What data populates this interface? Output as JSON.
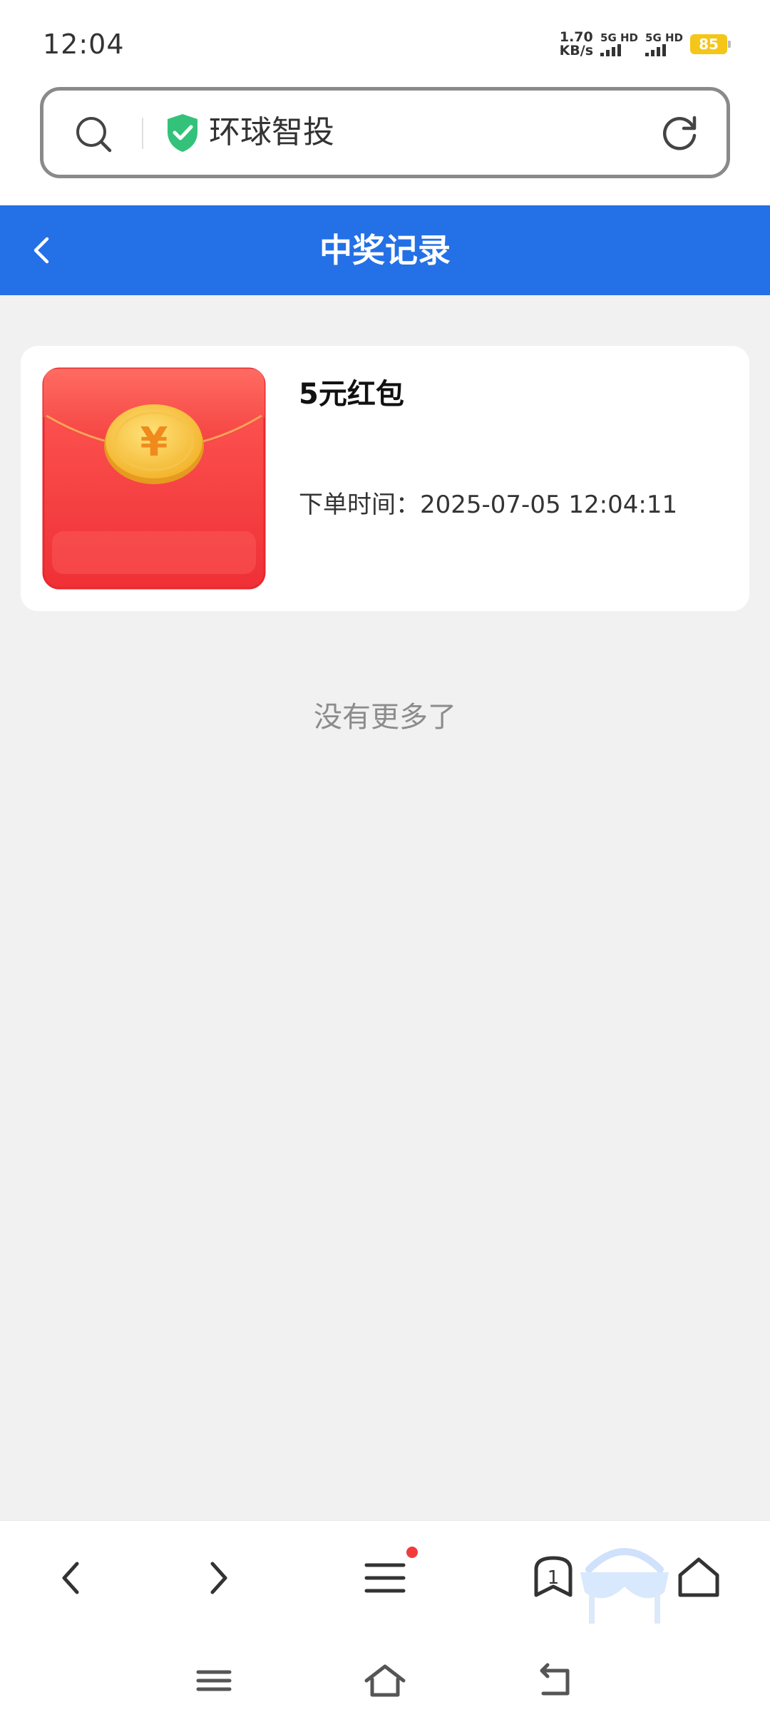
{
  "status_bar": {
    "time": "12:04",
    "net_speed_value": "1.70",
    "net_speed_unit": "KB/s",
    "sim1_label": "5G HD",
    "sim2_label": "5G HD",
    "battery": "85"
  },
  "address_bar": {
    "site_name": "环球智投",
    "icons": [
      "search-icon",
      "shield-check-icon",
      "refresh-icon"
    ]
  },
  "header": {
    "title": "中奖记录",
    "back_icon": "chevron-left-icon"
  },
  "records": [
    {
      "prize_name": "5元红包",
      "order_time": "下单时间：2025-07-05 12:04:11",
      "image": "red-envelope-icon"
    }
  ],
  "list_footer": "没有更多了",
  "toolbar": {
    "icons": [
      "back-icon",
      "forward-icon",
      "menu-icon",
      "bookmark-icon",
      "home-icon"
    ],
    "tab_count": "1"
  },
  "system_nav": {
    "icons": [
      "recents-icon",
      "home-icon",
      "back-icon"
    ]
  },
  "colors": {
    "header_bg": "#2470e6",
    "page_bg": "#f1f1f1",
    "envelope_red": "#f23a3e",
    "coin_gold": "#f8c840",
    "shield_green": "#34c27a",
    "battery": "#f5c518"
  }
}
